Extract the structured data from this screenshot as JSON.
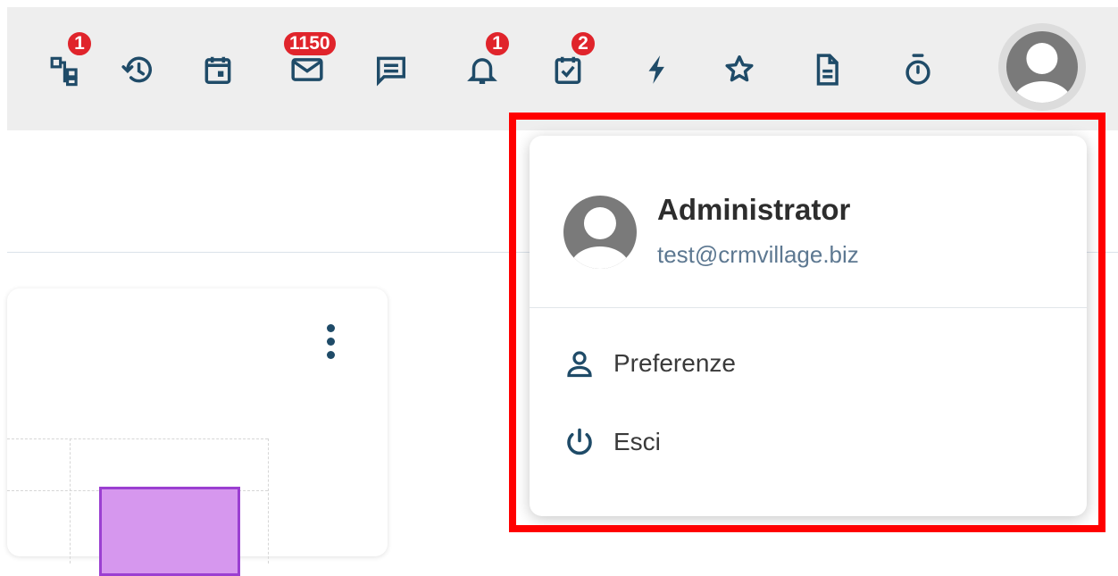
{
  "colors": {
    "icon": "#1f4b68",
    "badge": "#e0242b",
    "topbar": "#eeeeee",
    "highlight": "#ff0000",
    "bar_fill": "#d697ee",
    "bar_stroke": "#9b3fd1"
  },
  "toolbar": {
    "items": [
      {
        "icon": "sitemap-icon",
        "badge": "1"
      },
      {
        "icon": "history-icon",
        "badge": ""
      },
      {
        "icon": "calendar-icon",
        "badge": ""
      },
      {
        "icon": "mail-icon",
        "badge": "1150"
      },
      {
        "icon": "chat-icon",
        "badge": ""
      },
      {
        "icon": "bell-icon",
        "badge": "1"
      },
      {
        "icon": "task-check-icon",
        "badge": "2"
      },
      {
        "icon": "lightning-icon",
        "badge": ""
      },
      {
        "icon": "star-icon",
        "badge": ""
      },
      {
        "icon": "document-icon",
        "badge": ""
      },
      {
        "icon": "stopwatch-icon",
        "badge": ""
      }
    ]
  },
  "user_menu": {
    "name": "Administrator",
    "email": "test@crmvillage.biz",
    "items": [
      {
        "icon": "user-icon",
        "label": "Preferenze"
      },
      {
        "icon": "power-icon",
        "label": "Esci"
      }
    ]
  }
}
